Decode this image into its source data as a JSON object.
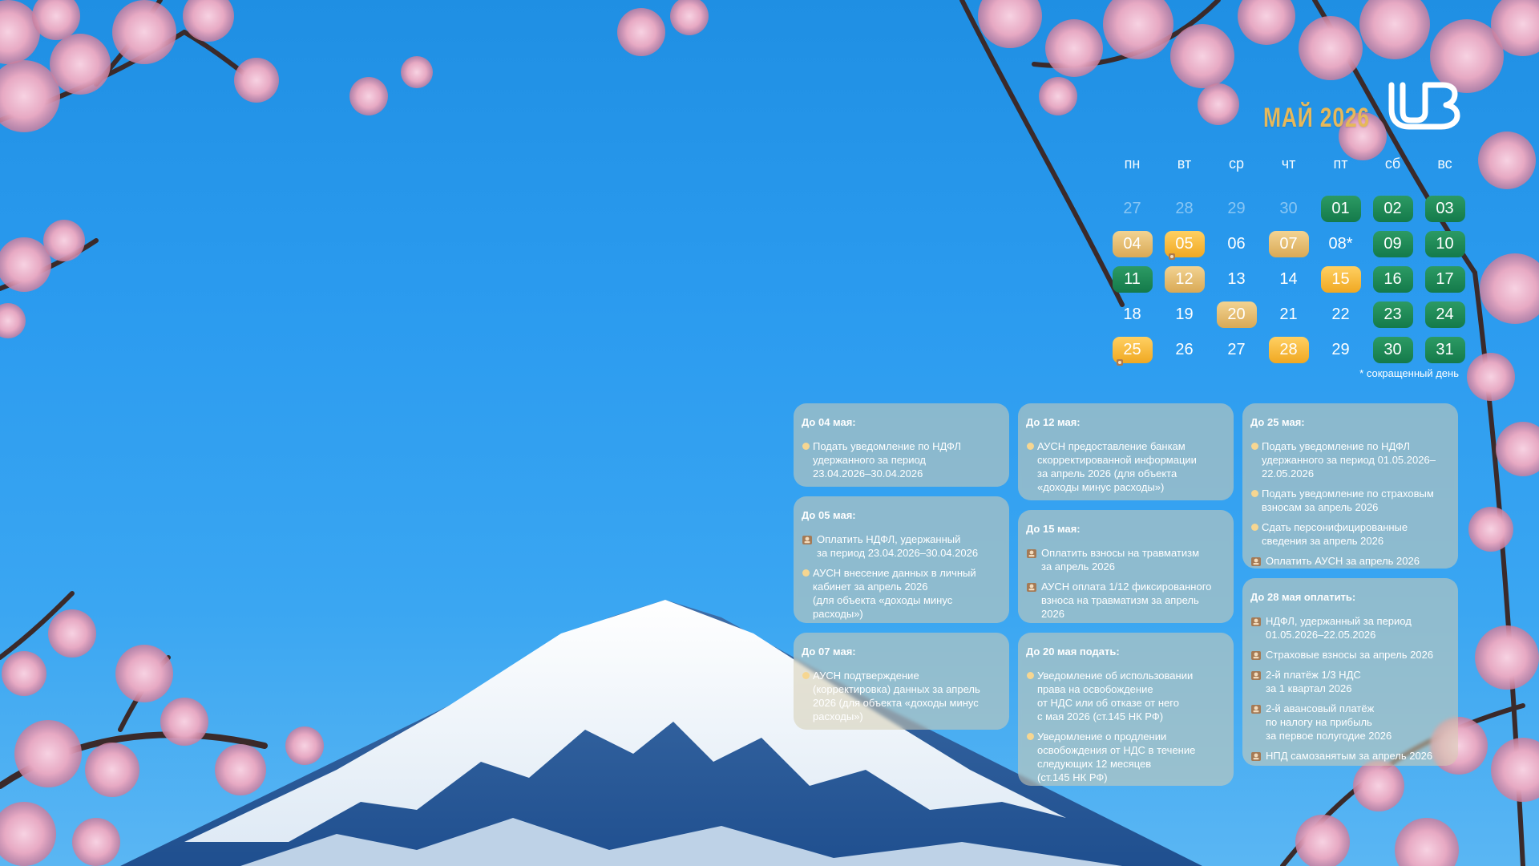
{
  "header": {
    "month_title": "МАЙ 2026",
    "logo_icon": "ub-logo-icon"
  },
  "colors": {
    "gold_accent": "#e6b85a",
    "green_day": "#1e8a55",
    "gold_day": "#e5bd72",
    "amber_day": "#f6b93a"
  },
  "calendar": {
    "weekdays": [
      "пн",
      "вт",
      "ср",
      "чт",
      "пт",
      "сб",
      "вс"
    ],
    "weeks": [
      [
        {
          "label": "27",
          "style": "other"
        },
        {
          "label": "28",
          "style": "other"
        },
        {
          "label": "29",
          "style": "other"
        },
        {
          "label": "30",
          "style": "other"
        },
        {
          "label": "01",
          "style": "green"
        },
        {
          "label": "02",
          "style": "green"
        },
        {
          "label": "03",
          "style": "green"
        }
      ],
      [
        {
          "label": "04",
          "style": "gold"
        },
        {
          "label": "05",
          "style": "amber",
          "mark": true
        },
        {
          "label": "06",
          "style": "plain"
        },
        {
          "label": "07",
          "style": "gold"
        },
        {
          "label": "08*",
          "style": "plain"
        },
        {
          "label": "09",
          "style": "green"
        },
        {
          "label": "10",
          "style": "green"
        }
      ],
      [
        {
          "label": "11",
          "style": "green"
        },
        {
          "label": "12",
          "style": "gold"
        },
        {
          "label": "13",
          "style": "plain"
        },
        {
          "label": "14",
          "style": "plain"
        },
        {
          "label": "15",
          "style": "amber"
        },
        {
          "label": "16",
          "style": "green"
        },
        {
          "label": "17",
          "style": "green"
        }
      ],
      [
        {
          "label": "18",
          "style": "plain"
        },
        {
          "label": "19",
          "style": "plain"
        },
        {
          "label": "20",
          "style": "gold"
        },
        {
          "label": "21",
          "style": "plain"
        },
        {
          "label": "22",
          "style": "plain"
        },
        {
          "label": "23",
          "style": "green"
        },
        {
          "label": "24",
          "style": "green"
        }
      ],
      [
        {
          "label": "25",
          "style": "amber",
          "mark": true
        },
        {
          "label": "26",
          "style": "plain"
        },
        {
          "label": "27",
          "style": "plain"
        },
        {
          "label": "28",
          "style": "amber"
        },
        {
          "label": "29",
          "style": "plain"
        },
        {
          "label": "30",
          "style": "green"
        },
        {
          "label": "31",
          "style": "green"
        }
      ]
    ],
    "footnote": "* сокращенный день"
  },
  "cards": [
    {
      "title": "До 04 мая:",
      "items": [
        {
          "text": "Подать уведомление по НДФЛ\nудержанного за период\n23.04.2026–30.04.2026",
          "kind": "notice"
        }
      ]
    },
    {
      "title": "До 05 мая:",
      "items": [
        {
          "text": "Оплатить НДФЛ, удержанный\nза период 23.04.2026–30.04.2026",
          "kind": "pay"
        },
        {
          "text": "АУСН внесение данных в личный\nкабинет за апрель 2026\n(для объекта «доходы минус\nрасходы»)",
          "kind": "notice"
        }
      ]
    },
    {
      "title": "До 07 мая:",
      "items": [
        {
          "text": "АУСН подтверждение\n(корректировка) данных за апрель\n2026 (для объекта «доходы минус\nрасходы»)",
          "kind": "notice"
        }
      ]
    },
    {
      "title": "До 12 мая:",
      "items": [
        {
          "text": "АУСН предоставление банкам\nскорректированной информации\nза апрель 2026 (для объекта\n«доходы минус расходы»)",
          "kind": "notice"
        }
      ]
    },
    {
      "title": "До 15 мая:",
      "items": [
        {
          "text": "Оплатить взносы на травматизм\nза апрель 2026",
          "kind": "pay"
        },
        {
          "text": "АУСН оплата 1/12 фиксированного\nвзноса на травматизм за апрель\n2026",
          "kind": "pay"
        }
      ]
    },
    {
      "title": "До 20 мая подать:",
      "items": [
        {
          "text": "Уведомление об использовании\nправа на освобождение\nот НДС или об отказе от него\nс мая 2026 (ст.145 НК РФ)",
          "kind": "notice"
        },
        {
          "text": "Уведомление о продлении\nосвобождения от НДС в течение\nследующих 12 месяцев\n(ст.145 НК РФ)",
          "kind": "notice"
        }
      ]
    },
    {
      "title": "До 25 мая:",
      "items": [
        {
          "text": "Подать уведомление по НДФЛ\nудержанного за период 01.05.2026–\n22.05.2026",
          "kind": "notice"
        },
        {
          "text": "Подать уведомление по страховым\nвзносам за апрель 2026",
          "kind": "notice"
        },
        {
          "text": "Сдать персонифицированные\nсведения за апрель 2026",
          "kind": "notice"
        },
        {
          "text": "Оплатить АУСН за апрель 2026",
          "kind": "pay"
        }
      ]
    },
    {
      "title": "До 28 мая оплатить:",
      "items": [
        {
          "text": "НДФЛ, удержанный за период\n01.05.2026–22.05.2026",
          "kind": "pay"
        },
        {
          "text": "Страховые взносы за апрель 2026",
          "kind": "pay"
        },
        {
          "text": "2-й платёж 1/3 НДС\nза 1 квартал 2026",
          "kind": "pay"
        },
        {
          "text": "2-й авансовый платёж\nпо налогу на прибыль\nза первое полугодие 2026",
          "kind": "pay"
        },
        {
          "text": "НПД самозанятым за апрель 2026",
          "kind": "pay"
        }
      ]
    }
  ]
}
